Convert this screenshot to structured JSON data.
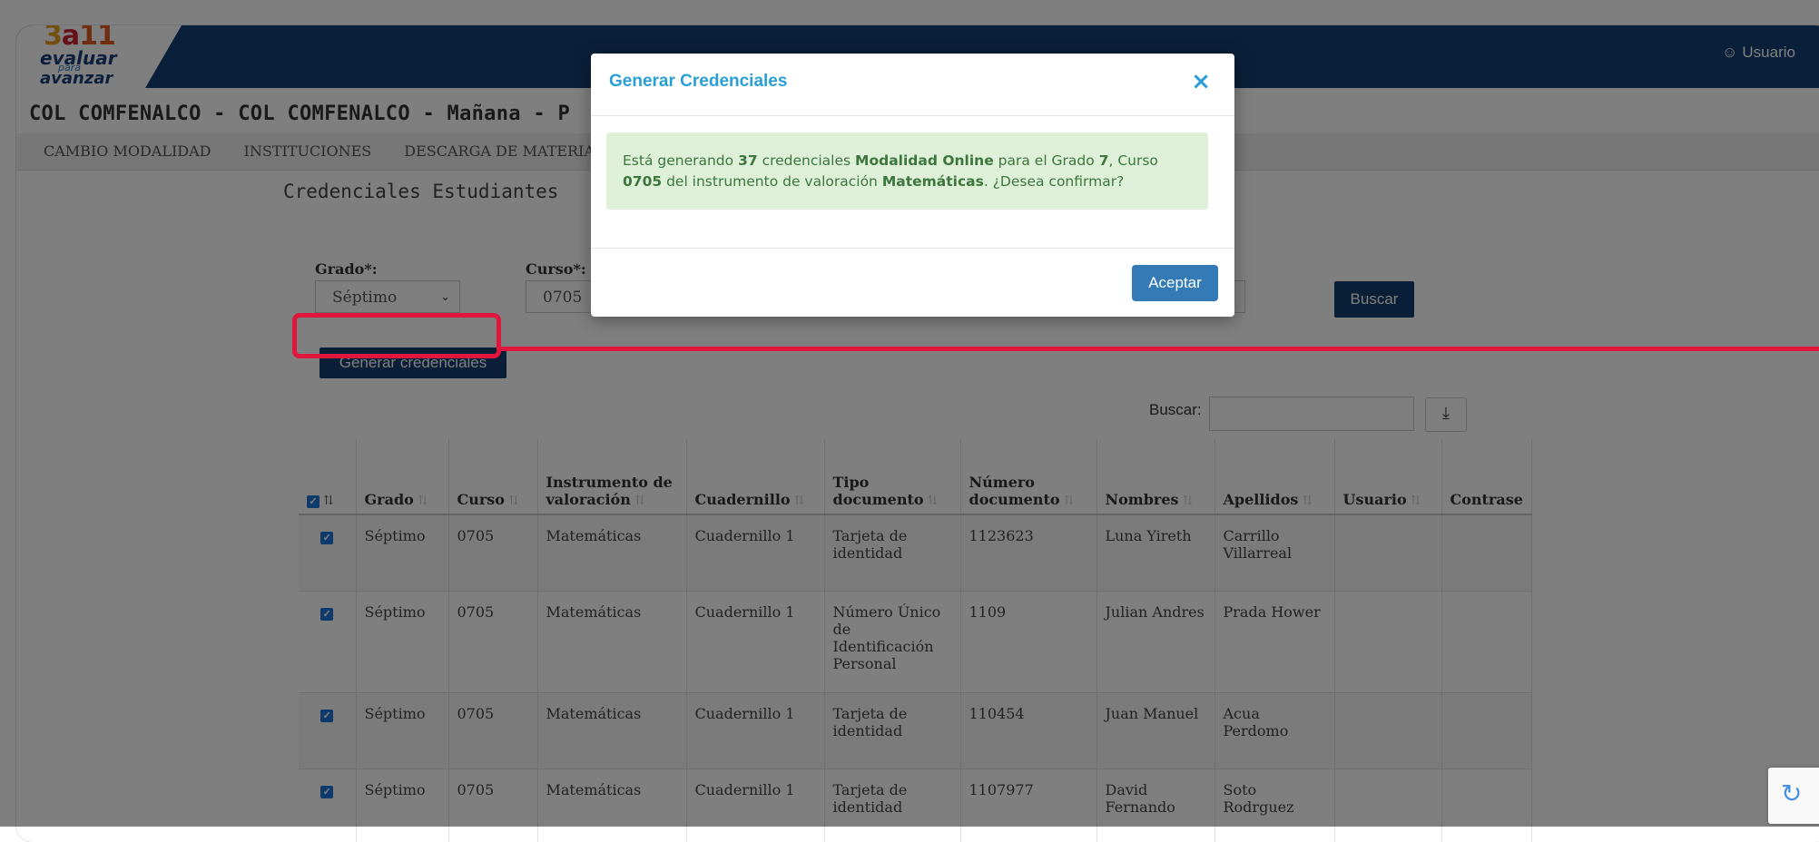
{
  "app": {
    "logo": {
      "number": [
        "3",
        "a",
        "11"
      ],
      "line1": "evaluar",
      "line2": "para",
      "line3": "avanzar"
    },
    "user_label": "Usuario"
  },
  "header": {
    "subtitle": "COL COMFENALCO - COL COMFENALCO - Mañana - P"
  },
  "nav": {
    "items": [
      "CAMBIO MODALIDAD",
      "INSTITUCIONES",
      "DESCARGA DE MATERIAL"
    ]
  },
  "page": {
    "section_title": "Credenciales Estudiantes",
    "grado_label": "Grado*:",
    "grado_value": "Séptimo",
    "curso_label": "Curso*:",
    "curso_value": "0705",
    "buscar_button": "Buscar",
    "generate_button": "Generar credenciales",
    "search_label": "Buscar:",
    "search_value": ""
  },
  "table": {
    "headers": {
      "grado": "Grado",
      "curso": "Curso",
      "instrumento": "Instrumento de valoración",
      "cuadernillo": "Cuadernillo",
      "tipo": "Tipo documento",
      "numero": "Número documento",
      "nombres": "Nombres",
      "apellidos": "Apellidos",
      "usuario": "Usuario",
      "contrasena": "Contrase"
    },
    "rows": [
      {
        "grado": "Séptimo",
        "curso": "0705",
        "instrumento": "Matemáticas",
        "cuadernillo": "Cuadernillo 1",
        "tipo": "Tarjeta de identidad",
        "numero": "1123623",
        "nombres": "Luna Yireth",
        "apellidos": "Carrillo Villarreal",
        "usuario": "",
        "contrasena": ""
      },
      {
        "grado": "Séptimo",
        "curso": "0705",
        "instrumento": "Matemáticas",
        "cuadernillo": "Cuadernillo 1",
        "tipo": "Número Único de Identificación Personal",
        "numero": "1109",
        "nombres": "Julian Andres",
        "apellidos": "Prada Hower",
        "usuario": "",
        "contrasena": ""
      },
      {
        "grado": "Séptimo",
        "curso": "0705",
        "instrumento": "Matemáticas",
        "cuadernillo": "Cuadernillo 1",
        "tipo": "Tarjeta de identidad",
        "numero": "110454",
        "nombres": "Juan Manuel",
        "apellidos": "Acua Perdomo",
        "usuario": "",
        "contrasena": ""
      },
      {
        "grado": "Séptimo",
        "curso": "0705",
        "instrumento": "Matemáticas",
        "cuadernillo": "Cuadernillo 1",
        "tipo": "Tarjeta de identidad",
        "numero": "1107977",
        "nombres": "David Fernando",
        "apellidos": "Soto Rodrguez",
        "usuario": "",
        "contrasena": ""
      }
    ]
  },
  "modal": {
    "title": "Generar Credenciales",
    "close_symbol": "×",
    "message": {
      "p1": "Está generando ",
      "count": "37",
      "p2": " credenciales ",
      "modality": "Modalidad Online",
      "p3": " para el Grado ",
      "grade": "7",
      "p4": ", Curso ",
      "course": "0705",
      "p5": " del instrumento de valoración ",
      "instrument": "Matemáticas",
      "p6": ". ¿Desea confirmar?"
    },
    "accept_button": "Aceptar"
  },
  "colors": {
    "header_bg": "#143f73",
    "highlight": "#e1163c",
    "modal_title": "#2a9fd6",
    "primary_button": "#337ab7",
    "alert_bg": "#dff0d8"
  },
  "icons": {
    "user": "user-icon",
    "close": "close-icon",
    "download": "download-icon",
    "sort": "sort-icon",
    "checkbox": "checkbox-icon"
  }
}
